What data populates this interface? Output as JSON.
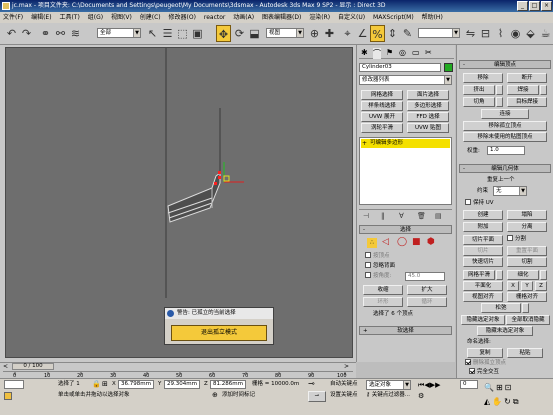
{
  "titlebar": {
    "text": "jc.max  - 项目文件夹: C:\\Documents and Settings\\peugeot\\My Documents\\3dsmax   - Autodesk 3ds Max 9 SP2   - 显示 : Direct 3D",
    "min": "_",
    "max": "□",
    "close": "×"
  },
  "menu": [
    "文件(F)",
    "编辑(E)",
    "工具(T)",
    "组(G)",
    "视图(V)",
    "创建(C)",
    "修改器(O)",
    "reactor",
    "动画(A)",
    "图表编辑器(D)",
    "渲染(R)",
    "自定义(U)",
    "MAXScript(M)",
    "帮助(H)"
  ],
  "toolbar": {
    "selection_filter": "全部",
    "ref_coord": "视图",
    "named_set": ""
  },
  "modify_panel": {
    "object_name": "Cylinder03",
    "color": "#22aa22",
    "modifier_list": "修改器列表",
    "buttons": [
      [
        "网格选择",
        "面片选择"
      ],
      [
        "样条线选择",
        "多边形选择"
      ],
      [
        "UVW 展开",
        "FFD 选择"
      ],
      [
        "涡轮平滑",
        "UVW 贴图"
      ]
    ],
    "stack_item": "可编辑多边形",
    "selection": {
      "header": "选择",
      "by_vertex": "按顶点",
      "ignore_backfacing": "忽略背面",
      "by_angle": "按角度:",
      "angle_value": "45.0",
      "shrink": "收缩",
      "grow": "扩大",
      "ring": "环形",
      "loop": "循环",
      "status": "选择了 6 个顶点"
    },
    "soft_selection": "软选择"
  },
  "edit_vertices": {
    "header": "编辑顶点",
    "remove": "移除",
    "break": "断开",
    "extrude": "挤出",
    "weld": "焊接",
    "chamfer": "切角",
    "target_weld": "目标焊接",
    "connect": "连接",
    "remove_isolated": "移除孤立顶点",
    "remove_unused_map": "移除未使用的贴图顶点",
    "weight_label": "权重:",
    "weight_value": "1.0"
  },
  "edit_geometry": {
    "header": "编辑几何体",
    "repeat_last": "重复上一个",
    "constraints": "约束",
    "constraint_value": "无",
    "preserve_uv": "保持 UV",
    "create": "创建",
    "collapse": "塌陷",
    "attach": "附加",
    "detach": "分离",
    "slice_plane": "切片平面",
    "split": "分割",
    "slice": "切片",
    "reset_plane": "重置平面",
    "quickslice": "快速切片",
    "cut": "切割",
    "meshsmooth": "网格平滑",
    "tessellate": "细化",
    "planarize": "平面化",
    "x": "X",
    "y": "Y",
    "z": "Z",
    "view_align": "视图对齐",
    "grid_align": "栅格对齐",
    "relax": "松弛",
    "hide_selected": "隐藏选定对象",
    "unhide_all": "全部取消隐藏",
    "hide_unselected": "隐藏未选定对象",
    "named_selections": "命名选择:",
    "copy": "复制",
    "paste": "粘贴",
    "delete_isolated": "删除孤立顶点",
    "full_interactivity": "完全交互"
  },
  "dialog": {
    "title": "警告: 已孤立的当前选择",
    "exit_button": "退出孤立模式"
  },
  "timeline": {
    "frame": "0 / 100",
    "ticks": [
      "0",
      "10",
      "20",
      "30",
      "40",
      "50",
      "60",
      "70",
      "80",
      "90",
      "100"
    ]
  },
  "statusbar": {
    "selected": "选择了 1",
    "x_label": "X",
    "x": "36.798mm",
    "y_label": "Y",
    "y": "29.304mm",
    "z_label": "Z",
    "z": "81.286mm",
    "grid": "栅格 = 10000.0m",
    "prompt": "单击或单击并拖动以选择对象",
    "add_time_tag": "添加时间标记",
    "auto_key": "自动关键点",
    "set_key": "设置关键点",
    "key_filter_value": "选定对象",
    "key_filters": "关键点过滤器...",
    "frame_value": "0"
  }
}
